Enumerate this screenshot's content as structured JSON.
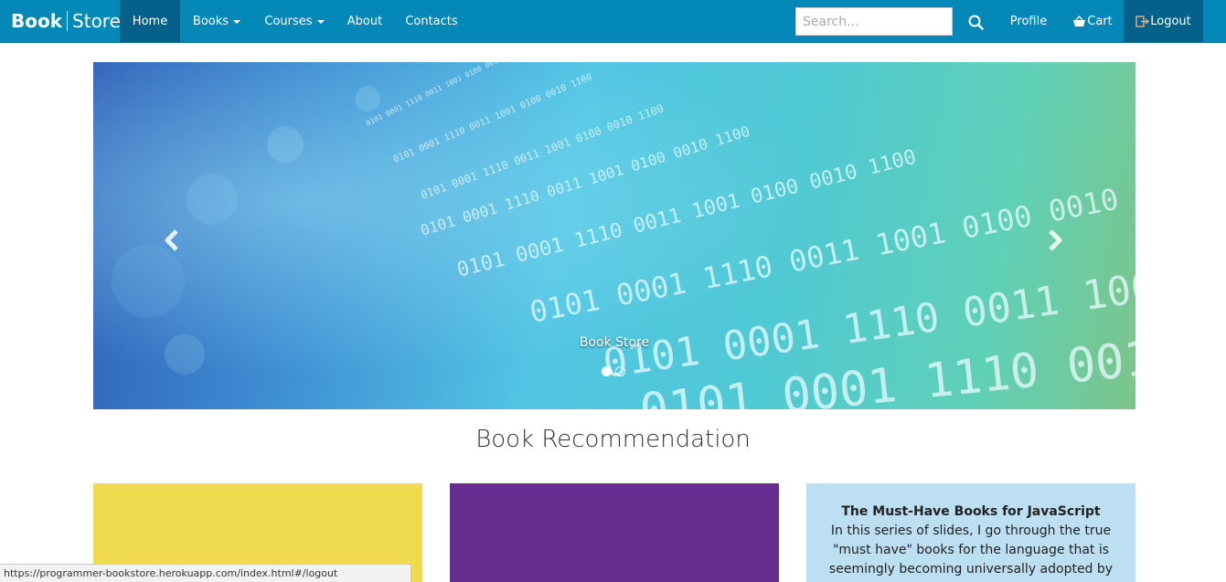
{
  "brand": {
    "bold": "Book",
    "light": "Store"
  },
  "nav": {
    "home": "Home",
    "books": "Books",
    "courses": "Courses",
    "about": "About",
    "contacts": "Contacts",
    "profile": "Profile",
    "cart": "Cart",
    "logout": "Logout"
  },
  "search": {
    "placeholder": "Search..."
  },
  "carousel": {
    "caption": "Book Store",
    "slide_count": 2,
    "active_index": 0,
    "binary_text": "0101 0001 1110 0011 1001 0100 0010 1100"
  },
  "section": {
    "title": "Book Recommendation"
  },
  "cards": [
    {
      "color": "#f0db4f"
    },
    {
      "color": "#662d91"
    },
    {
      "color": "#bcdff2",
      "title": "The Must-Have Books for JavaScript",
      "description": "In this series of slides, I go through the true \"must have\" books for the language that is seemingly becoming universally adopted by"
    }
  ],
  "status_bar": {
    "url": "https://programmer-bookstore.herokuapp.com/index.html#/logout"
  },
  "colors": {
    "navbar": "#0388b8",
    "nav_active": "#05608a"
  }
}
